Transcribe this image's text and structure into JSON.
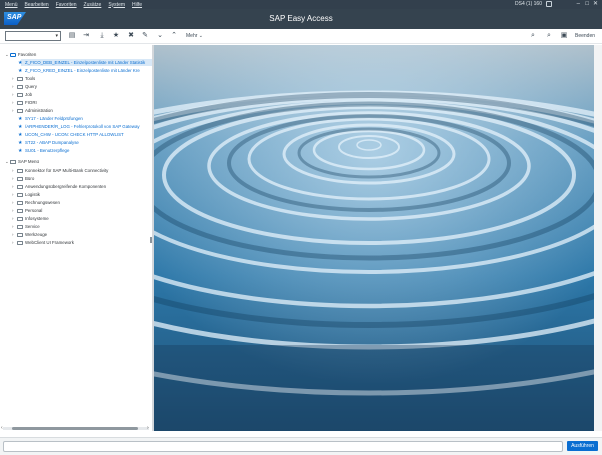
{
  "menubar": {
    "items": [
      "Menü",
      "Bearbeiten",
      "Favoriten",
      "Zusätze",
      "System",
      "Hilfe"
    ],
    "system_info": "DS4 (1) 160"
  },
  "titlebar": {
    "logo_text": "SAP",
    "title": "SAP Easy Access"
  },
  "toolbar": {
    "more_label": "Mehr",
    "exit_label": "Beenden"
  },
  "tree": {
    "favorites_label": "Favoriten",
    "favorites": [
      {
        "label": "Z_FICO_DEB_EINZEL - Einzelposten­liste mit Länder Stati­stik",
        "type": "transaction"
      },
      {
        "label": "Z_FICO_KRED_EINZEL - Einzelpostenliste mit Länder Kre",
        "type": "transaction"
      },
      {
        "label": "Tools",
        "type": "folder"
      },
      {
        "label": "Query",
        "type": "folder"
      },
      {
        "label": "Job",
        "type": "folder"
      },
      {
        "label": "FIORI",
        "type": "folder"
      },
      {
        "label": "Administration",
        "type": "folder"
      },
      {
        "label": "SY17 - Länder Feldprüfungen",
        "type": "transaction"
      },
      {
        "label": "/ARPHENDER/R_LOG - Fehlerprotokoll von SAP Gateway",
        "type": "transaction"
      },
      {
        "label": "UCON_CHW - UCON: CHECK HTTP ALLOWLIST",
        "type": "transaction"
      },
      {
        "label": "ST22 - ABAP Dumpanalyse",
        "type": "transaction"
      },
      {
        "label": "SU01 - Benutzerpflege",
        "type": "transaction"
      }
    ],
    "sapmenu_label": "SAP Menü",
    "sapmenu": [
      "Konnektor für SAP Multi-Bank Connectivity",
      "Büro",
      "Anwendungsübergreifende Komponenten",
      "Logistik",
      "Rechnungswesen",
      "Personal",
      "Infosysteme",
      "Service",
      "Werkzeuge",
      "WebClient UI Framework"
    ]
  },
  "statusbar": {
    "run_label": "Ausführen"
  }
}
